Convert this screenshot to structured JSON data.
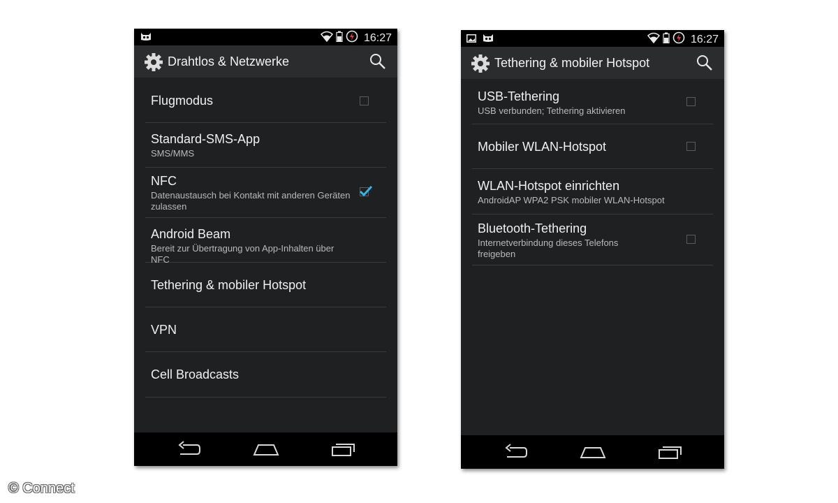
{
  "status_bar": {
    "time": "16:27"
  },
  "left_screen": {
    "title": "Drahtlos & Netzwerke",
    "items": [
      {
        "title": "Flugmodus",
        "subtitle": "",
        "checkbox": true,
        "checked": false
      },
      {
        "title": "Standard-SMS-App",
        "subtitle": "SMS/MMS",
        "checkbox": false
      },
      {
        "title": "NFC",
        "subtitle": "Datenaustausch bei Kontakt mit anderen Geräten zulassen",
        "checkbox": true,
        "checked": true
      },
      {
        "title": "Android Beam",
        "subtitle": "Bereit zur Übertragung von App-Inhalten über NFC",
        "checkbox": false
      },
      {
        "title": "Tethering & mobiler Hotspot",
        "subtitle": "",
        "checkbox": false
      },
      {
        "title": "VPN",
        "subtitle": "",
        "checkbox": false
      },
      {
        "title": "Cell Broadcasts",
        "subtitle": "",
        "checkbox": false
      }
    ]
  },
  "right_screen": {
    "title": "Tethering & mobiler Hotspot",
    "items": [
      {
        "title": "USB-Tethering",
        "subtitle": "USB verbunden; Tethering aktivieren",
        "checkbox": true,
        "checked": false
      },
      {
        "title": "Mobiler WLAN-Hotspot",
        "subtitle": "",
        "checkbox": true,
        "checked": false
      },
      {
        "title": "WLAN-Hotspot einrichten",
        "subtitle": "AndroidAP WPA2 PSK mobiler WLAN-Hotspot",
        "checkbox": false
      },
      {
        "title": "Bluetooth-Tethering",
        "subtitle": "Internetverbindung dieses Telefons freigeben",
        "checkbox": true,
        "checked": false
      }
    ]
  },
  "icons": {
    "status_left": [
      "cyanogen-mascot-icon"
    ],
    "status_left_right_screen": [
      "image-notification-icon",
      "cyanogen-mascot-icon"
    ],
    "status_right": [
      "wifi-icon",
      "battery-icon",
      "charging-icon"
    ],
    "actionbar": [
      "gear-icon",
      "search-icon"
    ],
    "navbar": [
      "back-icon",
      "home-icon",
      "recent-apps-icon"
    ]
  },
  "colors": {
    "checkmark": "#33b5e5",
    "background": "#1f2022",
    "actionbar": "#2b2c2e"
  },
  "watermark": "© Connect"
}
